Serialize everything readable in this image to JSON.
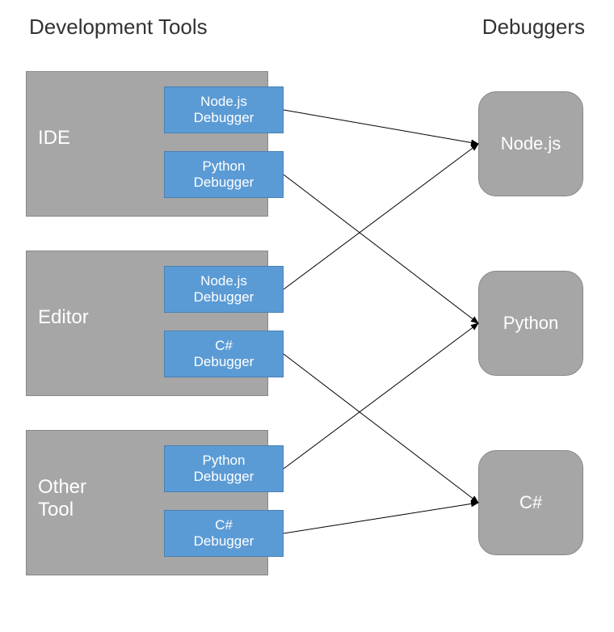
{
  "headers": {
    "left": "Development Tools",
    "right": "Debuggers"
  },
  "tools": [
    {
      "name": "IDE",
      "debuggers": [
        {
          "label": "Node.js\nDebugger",
          "target": "Node.js"
        },
        {
          "label": "Python\nDebugger",
          "target": "Python"
        }
      ]
    },
    {
      "name": "Editor",
      "debuggers": [
        {
          "label": "Node.js\nDebugger",
          "target": "Node.js"
        },
        {
          "label": "C#\nDebugger",
          "target": "C#"
        }
      ]
    },
    {
      "name": "Other\nTool",
      "debuggers": [
        {
          "label": "Python\nDebugger",
          "target": "Python"
        },
        {
          "label": "C#\nDebugger",
          "target": "C#"
        }
      ]
    }
  ],
  "targets": [
    {
      "name": "Node.js"
    },
    {
      "name": "Python"
    },
    {
      "name": "C#"
    }
  ],
  "connections": [
    {
      "from": "tool0-db0",
      "to": "target0"
    },
    {
      "from": "tool0-db1",
      "to": "target1"
    },
    {
      "from": "tool1-db0",
      "to": "target0"
    },
    {
      "from": "tool1-db1",
      "to": "target2"
    },
    {
      "from": "tool2-db0",
      "to": "target1"
    },
    {
      "from": "tool2-db1",
      "to": "target2"
    }
  ]
}
